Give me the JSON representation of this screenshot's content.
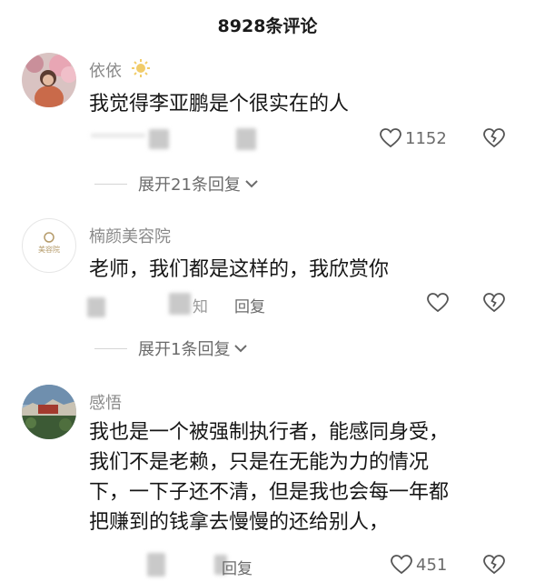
{
  "header": {
    "title": "8928条评论"
  },
  "comments": [
    {
      "username": "依依",
      "text_lines": [
        "我觉得李亚鹏是个很实在的人"
      ],
      "like_count": "1152",
      "expand_label": "展开21条回复"
    },
    {
      "username": "楠颜美容院",
      "avatar_text": "美容院",
      "text_lines": [
        "老师，我们都是这样的，我欣赏你"
      ],
      "meta_partial": "知",
      "reply_label": "回复",
      "expand_label": "展开1条回复"
    },
    {
      "username": "感悟",
      "text_lines": [
        "我也是一个被强制执行者，能感同身受，",
        "我们不是老赖，只是在无能为力的情况",
        "下，一下子还不清，但是我也会每一年都",
        "把赚到的钱拿去慢慢的还给别人，"
      ],
      "reply_label": "回复",
      "like_count": "451"
    }
  ],
  "icons": {
    "like": "heart-outline-icon",
    "dislike": "broken-heart-icon",
    "expand": "chevron-down-icon",
    "badge": "sun-badge-icon"
  }
}
